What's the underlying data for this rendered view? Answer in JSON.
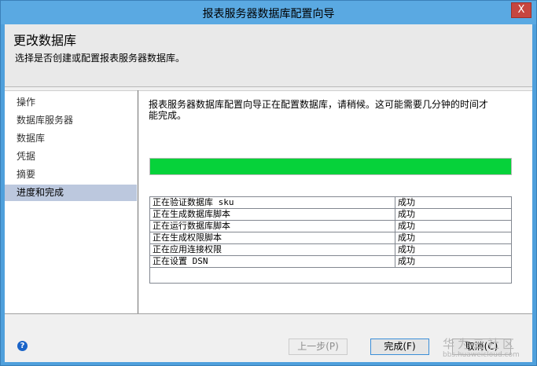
{
  "window": {
    "title": "报表服务器数据库配置向导",
    "close_glyph": "X"
  },
  "header": {
    "title": "更改数据库",
    "subtitle": "选择是否创建或配置报表服务器数据库。"
  },
  "nav": {
    "items": [
      {
        "label": "操作",
        "active": false
      },
      {
        "label": "数据库服务器",
        "active": false
      },
      {
        "label": "数据库",
        "active": false
      },
      {
        "label": "凭据",
        "active": false
      },
      {
        "label": "摘要",
        "active": false
      },
      {
        "label": "进度和完成",
        "active": true
      }
    ]
  },
  "main": {
    "description": "报表服务器数据库配置向导正在配置数据库，请稍候。这可能需要几分钟的时间才能完成。",
    "progress": 1.0,
    "progress_color": "#06d23a",
    "tasks": [
      {
        "task": "正在验证数据库 sku",
        "status": "成功"
      },
      {
        "task": "正在生成数据库脚本",
        "status": "成功"
      },
      {
        "task": "正在运行数据库脚本",
        "status": "成功"
      },
      {
        "task": "正在生成权限脚本",
        "status": "成功"
      },
      {
        "task": "正在应用连接权限",
        "status": "成功"
      },
      {
        "task": "正在设置 DSN",
        "status": "成功"
      }
    ]
  },
  "footer": {
    "help_glyph": "?",
    "back_label": "上一步(P)",
    "finish_label": "完成(F)",
    "cancel_label": "取消(C)"
  },
  "watermark": {
    "main": "华为云社区",
    "sub": "bbs.huaweicloud.com"
  },
  "colors": {
    "titlebar": "#5aa9e2",
    "active_nav": "#bcc8de"
  }
}
